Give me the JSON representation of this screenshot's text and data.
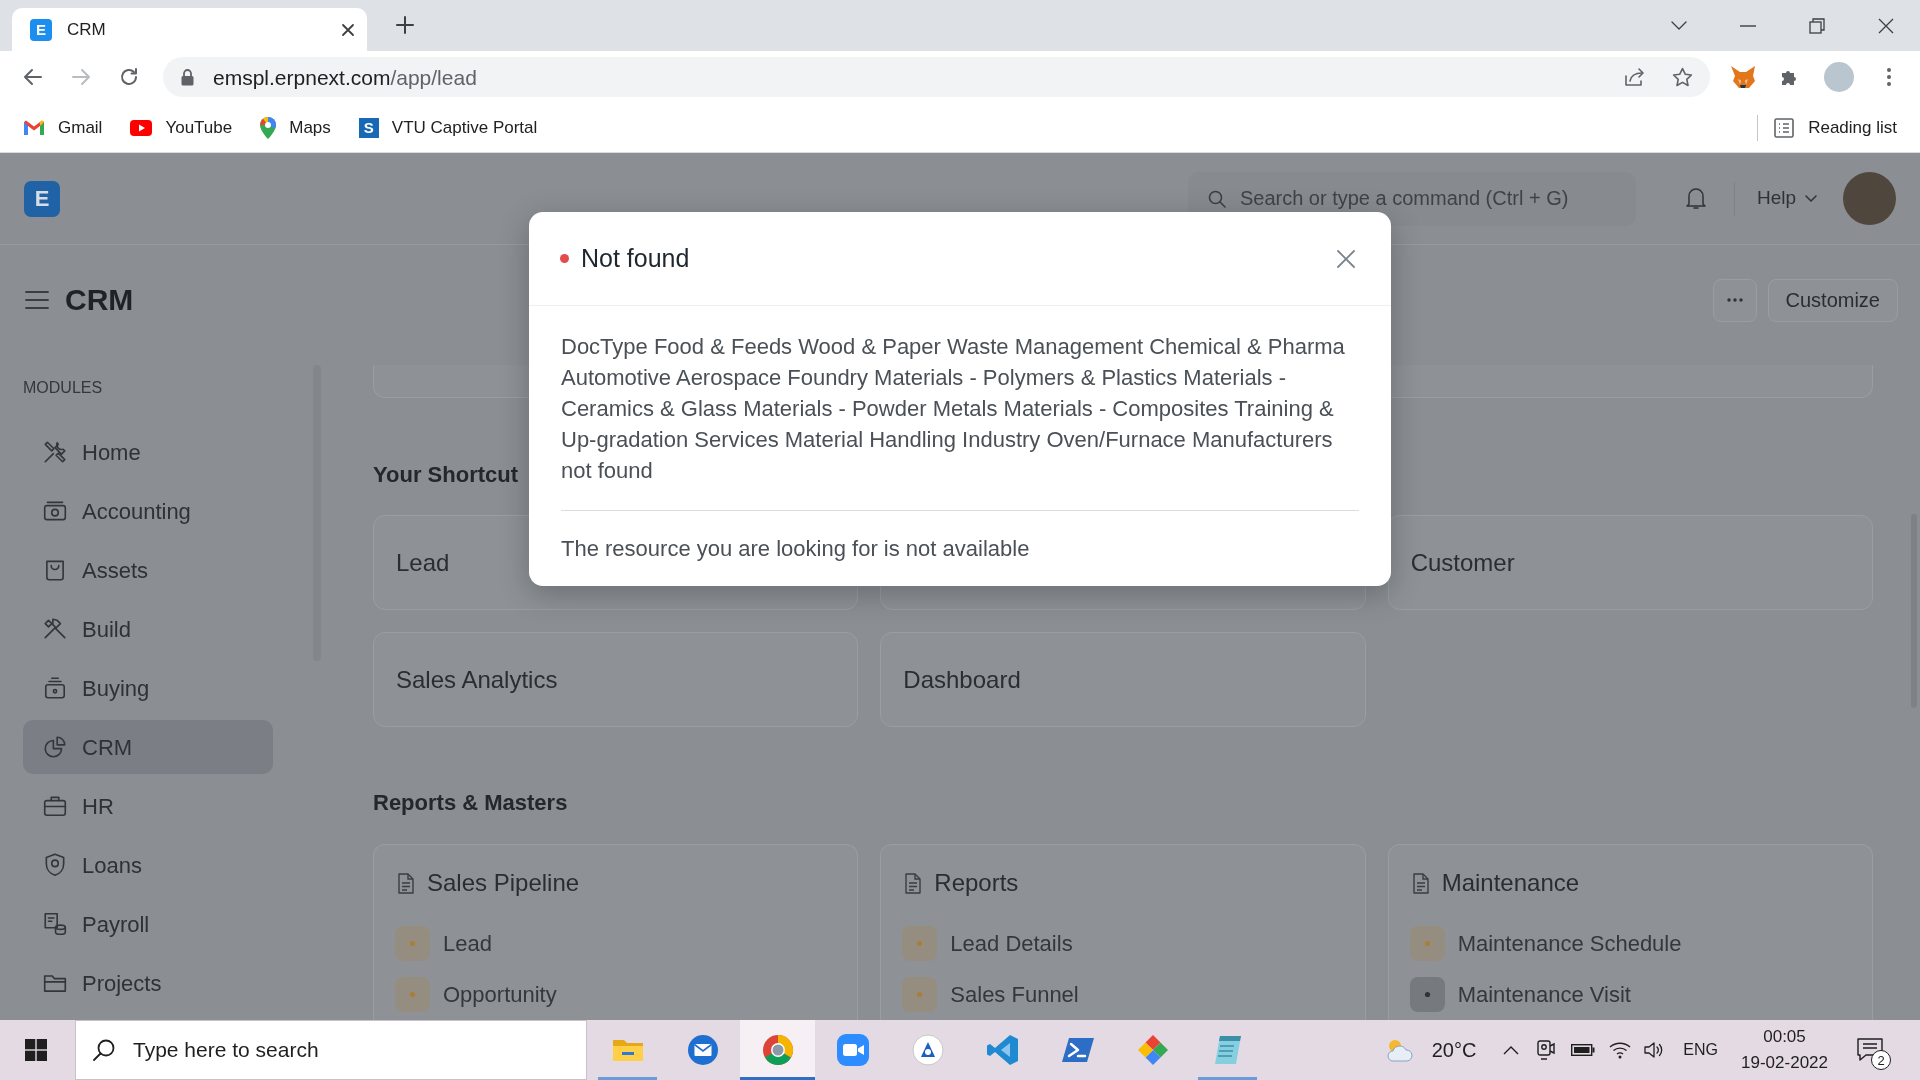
{
  "browser": {
    "tabs": [
      {
        "title": "CRM",
        "icon_letter": "E",
        "selected": true
      }
    ],
    "address": {
      "host": "emspl.erpnext.com",
      "path": "/app/lead"
    },
    "bookmarks": [
      {
        "label": "Gmail"
      },
      {
        "label": "YouTube"
      },
      {
        "label": "Maps"
      },
      {
        "label": "VTU Captive Portal",
        "icon_letter": "S"
      }
    ],
    "reading_list": "Reading list"
  },
  "navbar": {
    "logo_letter": "E",
    "search": {
      "placeholder": "Search or type a command (Ctrl + G)"
    },
    "help": "Help"
  },
  "page": {
    "title": "CRM",
    "customize": "Customize"
  },
  "sidebar": {
    "heading": "MODULES",
    "items": [
      {
        "label": "Home",
        "selected": false
      },
      {
        "label": "Accounting",
        "selected": false
      },
      {
        "label": "Assets",
        "selected": false
      },
      {
        "label": "Build",
        "selected": false
      },
      {
        "label": "Buying",
        "selected": false
      },
      {
        "label": "CRM",
        "selected": true
      },
      {
        "label": "HR",
        "selected": false
      },
      {
        "label": "Loans",
        "selected": false
      },
      {
        "label": "Payroll",
        "selected": false
      },
      {
        "label": "Projects",
        "selected": false
      }
    ]
  },
  "shortcuts": {
    "heading": "Your Shortcut",
    "cards": [
      {
        "kind": "shortcut",
        "label": "Lead"
      },
      {
        "kind": "covered"
      },
      {
        "kind": "shortcut",
        "label": "Customer"
      },
      {
        "kind": "shortcut",
        "label": "Sales Analytics"
      },
      {
        "kind": "shortcut",
        "label": "Dashboard"
      }
    ]
  },
  "reports": {
    "heading": "Reports & Masters",
    "cards": [
      {
        "title": "Sales Pipeline",
        "links": [
          {
            "label": "Lead",
            "color": "#a97e3a"
          },
          {
            "label": "Opportunity",
            "color": "#a97e3a"
          }
        ]
      },
      {
        "title": "Reports",
        "links": [
          {
            "label": "Lead Details",
            "color": "#a97e3a"
          },
          {
            "label": "Sales Funnel",
            "color": "#a97e3a"
          }
        ]
      },
      {
        "title": "Maintenance",
        "links": [
          {
            "label": "Maintenance Schedule",
            "color": "#a97e3a"
          },
          {
            "label": "Maintenance Visit",
            "color": "#2f3337"
          }
        ]
      }
    ]
  },
  "dialog": {
    "title": "Not found",
    "message": "DocType Food & Feeds Wood & Paper Waste Management Chemical & Pharma Automotive Aerospace Foundry Materials - Polymers & Plastics Materials - Ceramics & Glass Materials - Powder Metals Materials - Composites Training & Up-gradation Services Material Handling Industry Oven/Furnace Manufacturers not found",
    "footer": "The resource you are looking for is not available"
  },
  "taskbar": {
    "search": {
      "placeholder": "Type here to search"
    },
    "apps": [
      {
        "running": true,
        "selected": false
      },
      {
        "running": false,
        "selected": false
      },
      {
        "running": true,
        "selected": true
      },
      {
        "running": false,
        "selected": false
      },
      {
        "running": false,
        "selected": false
      },
      {
        "running": false,
        "selected": false
      },
      {
        "running": false,
        "selected": false
      },
      {
        "running": false,
        "selected": false
      },
      {
        "running": true,
        "selected": false
      }
    ],
    "weather": "20°C",
    "language": "ENG",
    "time": "00:05",
    "date": "19-02-2022",
    "notifications": "2"
  }
}
